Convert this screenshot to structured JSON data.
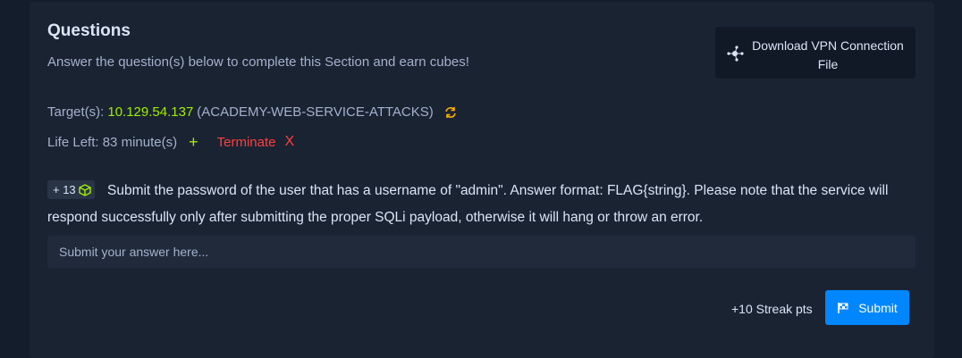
{
  "section": {
    "title": "Questions",
    "subtitle": "Answer the question(s) below to complete this Section and earn cubes!"
  },
  "vpn": {
    "label": "Download VPN Connection File",
    "icon": "network-icon"
  },
  "target": {
    "label": "Target(s):",
    "ip": "10.129.54.137",
    "name": "(ACADEMY-WEB-SERVICE-ATTACKS)",
    "icon": "refresh-icon"
  },
  "life": {
    "label": "Life Left:",
    "value": "83 minute(s)",
    "extend_label": "+",
    "terminate_label": "Terminate",
    "terminate_icon": "X"
  },
  "question": {
    "reward": "+ 13",
    "text": "Submit the password of the user that has a username of \"admin\". Answer format: FLAG{string}. Please note that the service will respond successfully only after submitting the proper SQLi payload, otherwise it will hang or throw an error.",
    "answer_placeholder": "Submit your answer here...",
    "answer_value": ""
  },
  "footer": {
    "streak": "+10 Streak pts",
    "submit_label": "Submit"
  },
  "colors": {
    "background": "#141d2b",
    "card": "#1a2332",
    "accent_green": "#9fef00",
    "danger": "#ff3e3e",
    "primary": "#0086ff"
  }
}
